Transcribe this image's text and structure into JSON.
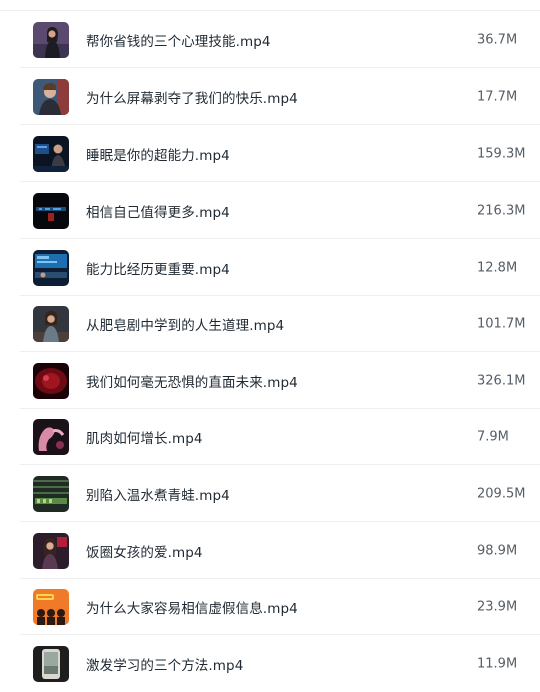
{
  "files": [
    {
      "name": "帮你省钱的三个心理技能.mp4",
      "size": "36.7M",
      "thumb": "video-thumbnail-woman-speaker"
    },
    {
      "name": "为什么屏幕剥夺了我们的快乐.mp4",
      "size": "17.7M",
      "thumb": "video-thumbnail-man-speaker"
    },
    {
      "name": "睡眠是你的超能力.mp4",
      "size": "159.3M",
      "thumb": "video-thumbnail-stage-speaker"
    },
    {
      "name": "相信自己值得更多.mp4",
      "size": "216.3M",
      "thumb": "video-thumbnail-dark-stage"
    },
    {
      "name": "能力比经历更重要.mp4",
      "size": "12.8M",
      "thumb": "video-thumbnail-blue-stage"
    },
    {
      "name": "从肥皂剧中学到的人生道理.mp4",
      "size": "101.7M",
      "thumb": "video-thumbnail-woman-speaker"
    },
    {
      "name": "我们如何毫无恐惧的直面未来.mp4",
      "size": "326.1M",
      "thumb": "video-thumbnail-red-stage"
    },
    {
      "name": "肌肉如何增长.mp4",
      "size": "7.9M",
      "thumb": "video-thumbnail-arm-illustration"
    },
    {
      "name": "别陷入温水煮青蛙.mp4",
      "size": "209.5M",
      "thumb": "video-thumbnail-green-stage"
    },
    {
      "name": "饭圈女孩的爱.mp4",
      "size": "98.9M",
      "thumb": "video-thumbnail-woman-speaker"
    },
    {
      "name": "为什么大家容易相信虚假信息.mp4",
      "size": "23.9M",
      "thumb": "video-thumbnail-orange-illustration"
    },
    {
      "name": "激发学习的三个方法.mp4",
      "size": "11.9M",
      "thumb": "video-thumbnail-phone-photo"
    }
  ],
  "colors": {
    "text": "#1f2933",
    "size_text": "#555d66",
    "divider": "#efefef"
  }
}
